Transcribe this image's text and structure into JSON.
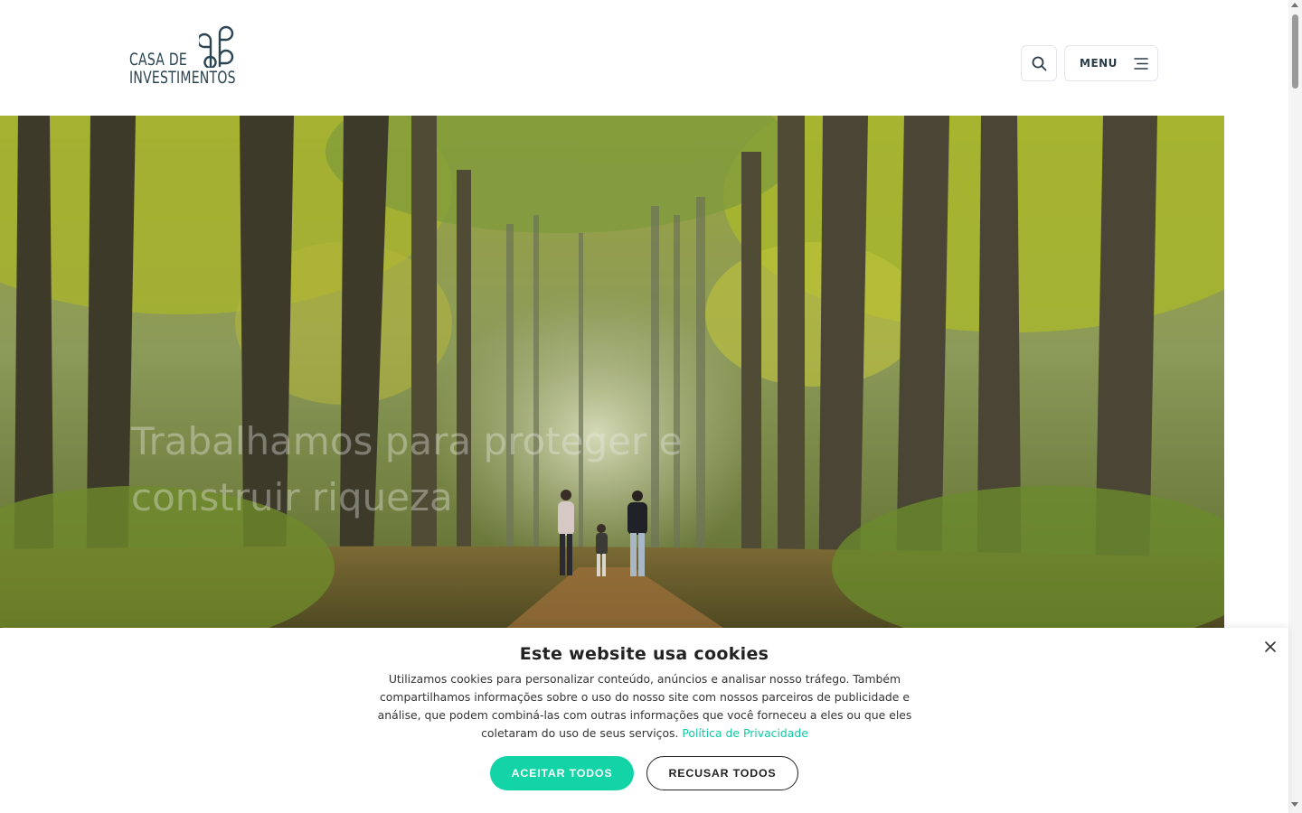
{
  "header": {
    "logo": {
      "line1": "CASA DE",
      "line2": "INVESTIMENTOS"
    },
    "menu_label": "MENU"
  },
  "hero": {
    "title": "Trabalhamos para proteger e construir riqueza"
  },
  "cookie_banner": {
    "title": "Este website usa cookies",
    "text": "Utilizamos cookies para personalizar conteúdo, anúncios e analisar nosso tráfego. Também compartilhamos informações sobre o uso do nosso site com nossos parceiros de publicidade e análise, que podem combiná-las com outras informações que você forneceu a eles ou que eles coletaram do uso de seus serviços.",
    "privacy_link": "Política de Privacidade",
    "accept_label": "ACEITAR TODOS",
    "reject_label": "RECUSAR TODOS"
  },
  "icons": {
    "search": "search-icon",
    "menu": "hamburger-icon",
    "close": "close-icon"
  },
  "colors": {
    "brand": "#2a4452",
    "accent": "#12d4a6",
    "link": "#12c9a2"
  }
}
